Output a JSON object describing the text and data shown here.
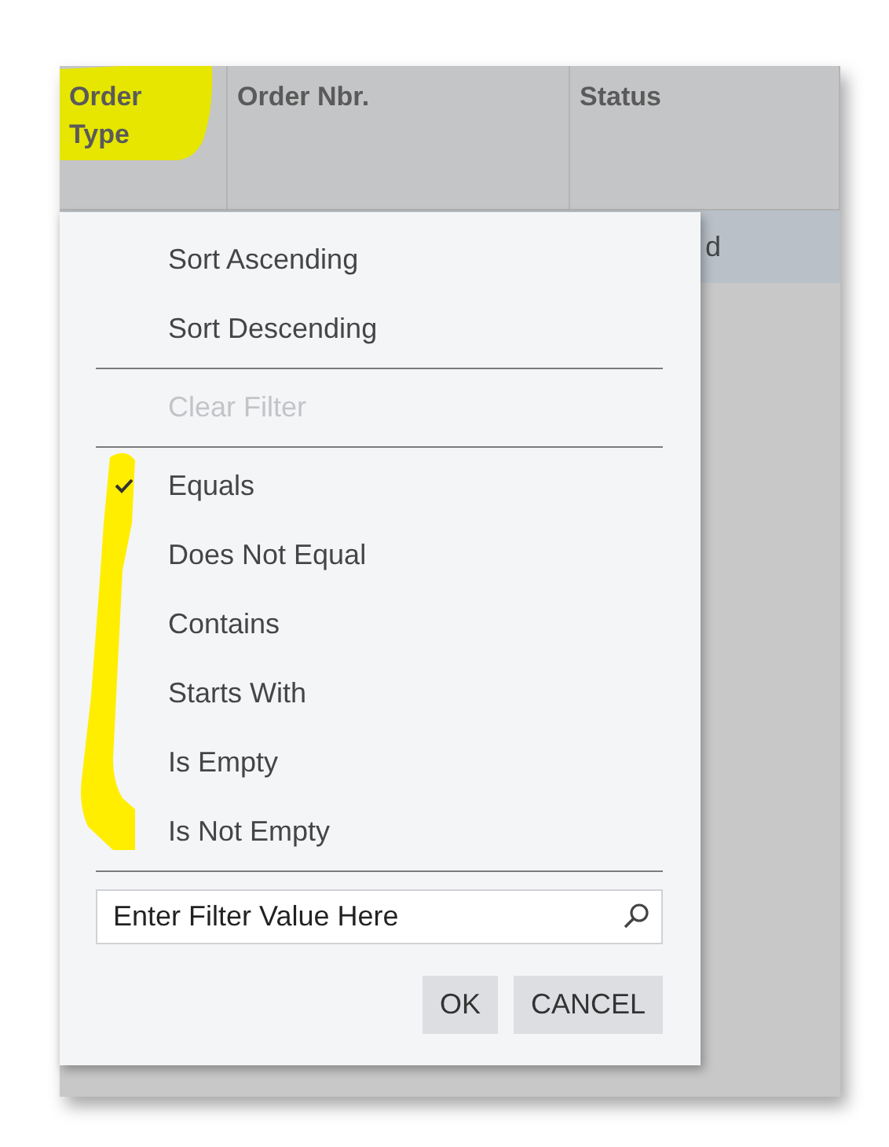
{
  "grid": {
    "columns": [
      {
        "label": "Order Type",
        "highlighted": true
      },
      {
        "label": "Order Nbr.",
        "highlighted": false
      },
      {
        "label": "Status",
        "highlighted": false
      }
    ],
    "row_fragment": "d"
  },
  "filter_menu": {
    "actions": [
      [
        {
          "label": "Sort Ascending",
          "disabled": false
        },
        {
          "label": "Sort Descending",
          "disabled": false
        }
      ],
      [
        {
          "label": "Clear Filter",
          "disabled": true
        }
      ]
    ],
    "conditions": [
      {
        "label": "Equals",
        "selected": true
      },
      {
        "label": "Does Not Equal",
        "selected": false
      },
      {
        "label": "Contains",
        "selected": false
      },
      {
        "label": "Starts With",
        "selected": false
      },
      {
        "label": "Is Empty",
        "selected": false
      },
      {
        "label": "Is Not Empty",
        "selected": false
      }
    ],
    "conditions_highlighted": true,
    "filter_field": {
      "placeholder": "Enter Filter Value Here"
    },
    "buttons": [
      "OK",
      "CANCEL"
    ]
  }
}
